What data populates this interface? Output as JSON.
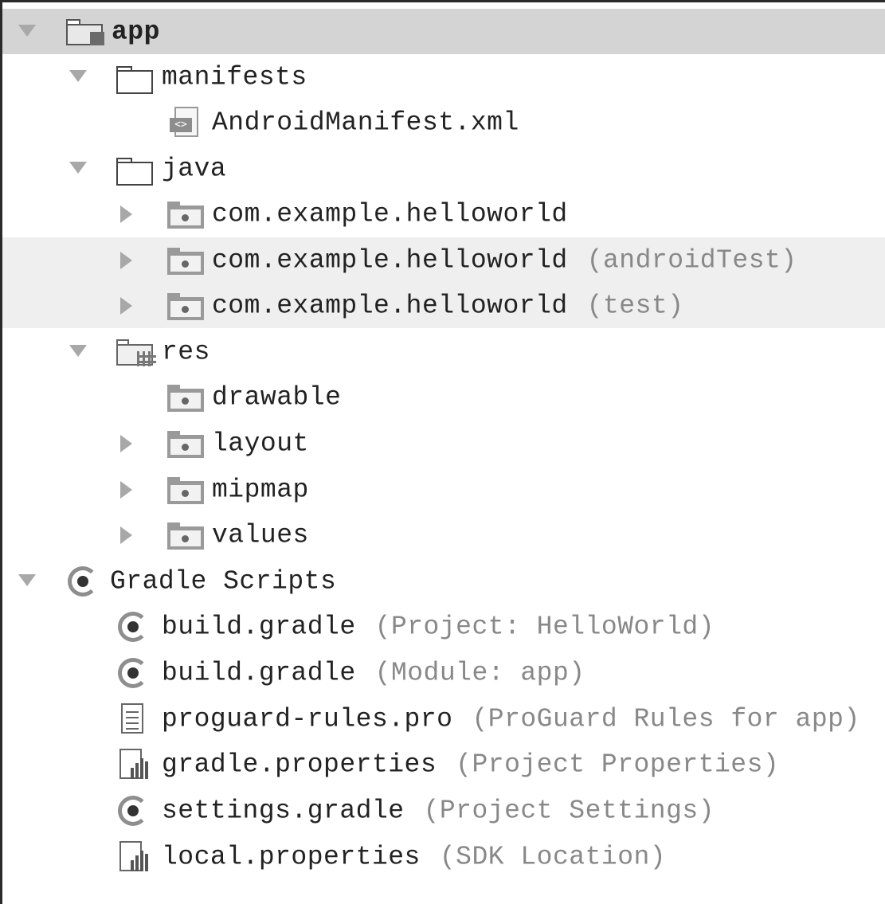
{
  "tree": {
    "app": {
      "label": "app"
    },
    "manifests": {
      "label": "manifests"
    },
    "android_manifest": {
      "label": "AndroidManifest.xml"
    },
    "java": {
      "label": "java"
    },
    "pkg_main": {
      "label": "com.example.helloworld",
      "hint": ""
    },
    "pkg_android_test": {
      "label": "com.example.helloworld",
      "hint": "(androidTest)"
    },
    "pkg_test": {
      "label": "com.example.helloworld",
      "hint": "(test)"
    },
    "res": {
      "label": "res"
    },
    "drawable": {
      "label": "drawable"
    },
    "layout": {
      "label": "layout"
    },
    "mipmap": {
      "label": "mipmap"
    },
    "values": {
      "label": "values"
    },
    "gradle_scripts": {
      "label": "Gradle Scripts"
    },
    "build_gradle_project": {
      "label": "build.gradle",
      "hint": "(Project: HelloWorld)"
    },
    "build_gradle_module": {
      "label": "build.gradle",
      "hint": "(Module: app)"
    },
    "proguard": {
      "label": "proguard-rules.pro",
      "hint": "(ProGuard Rules for app)"
    },
    "gradle_properties": {
      "label": "gradle.properties",
      "hint": "(Project Properties)"
    },
    "settings_gradle": {
      "label": "settings.gradle",
      "hint": "(Project Settings)"
    },
    "local_properties": {
      "label": "local.properties",
      "hint": "(SDK Location)"
    }
  },
  "icons": {
    "app": "module-folder-icon",
    "folder": "folder-icon",
    "package": "package-folder-icon",
    "res": "resource-folder-icon",
    "xml": "xml-file-icon",
    "gradle": "gradle-icon",
    "text": "text-file-icon",
    "properties": "properties-file-icon"
  },
  "colors": {
    "selected_row": "#d4d4d4",
    "highlight_row": "#efefef",
    "hint_text": "#888888",
    "text": "#222222"
  }
}
